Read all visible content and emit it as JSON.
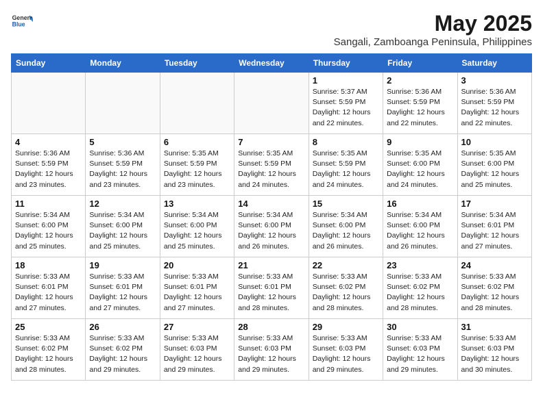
{
  "header": {
    "logo_general": "General",
    "logo_blue": "Blue",
    "month_title": "May 2025",
    "location": "Sangali, Zamboanga Peninsula, Philippines"
  },
  "days_of_week": [
    "Sunday",
    "Monday",
    "Tuesday",
    "Wednesday",
    "Thursday",
    "Friday",
    "Saturday"
  ],
  "weeks": [
    [
      {
        "day": "",
        "info": ""
      },
      {
        "day": "",
        "info": ""
      },
      {
        "day": "",
        "info": ""
      },
      {
        "day": "",
        "info": ""
      },
      {
        "day": "1",
        "info": "Sunrise: 5:37 AM\nSunset: 5:59 PM\nDaylight: 12 hours\nand 22 minutes."
      },
      {
        "day": "2",
        "info": "Sunrise: 5:36 AM\nSunset: 5:59 PM\nDaylight: 12 hours\nand 22 minutes."
      },
      {
        "day": "3",
        "info": "Sunrise: 5:36 AM\nSunset: 5:59 PM\nDaylight: 12 hours\nand 22 minutes."
      }
    ],
    [
      {
        "day": "4",
        "info": "Sunrise: 5:36 AM\nSunset: 5:59 PM\nDaylight: 12 hours\nand 23 minutes."
      },
      {
        "day": "5",
        "info": "Sunrise: 5:36 AM\nSunset: 5:59 PM\nDaylight: 12 hours\nand 23 minutes."
      },
      {
        "day": "6",
        "info": "Sunrise: 5:35 AM\nSunset: 5:59 PM\nDaylight: 12 hours\nand 23 minutes."
      },
      {
        "day": "7",
        "info": "Sunrise: 5:35 AM\nSunset: 5:59 PM\nDaylight: 12 hours\nand 24 minutes."
      },
      {
        "day": "8",
        "info": "Sunrise: 5:35 AM\nSunset: 5:59 PM\nDaylight: 12 hours\nand 24 minutes."
      },
      {
        "day": "9",
        "info": "Sunrise: 5:35 AM\nSunset: 6:00 PM\nDaylight: 12 hours\nand 24 minutes."
      },
      {
        "day": "10",
        "info": "Sunrise: 5:35 AM\nSunset: 6:00 PM\nDaylight: 12 hours\nand 25 minutes."
      }
    ],
    [
      {
        "day": "11",
        "info": "Sunrise: 5:34 AM\nSunset: 6:00 PM\nDaylight: 12 hours\nand 25 minutes."
      },
      {
        "day": "12",
        "info": "Sunrise: 5:34 AM\nSunset: 6:00 PM\nDaylight: 12 hours\nand 25 minutes."
      },
      {
        "day": "13",
        "info": "Sunrise: 5:34 AM\nSunset: 6:00 PM\nDaylight: 12 hours\nand 25 minutes."
      },
      {
        "day": "14",
        "info": "Sunrise: 5:34 AM\nSunset: 6:00 PM\nDaylight: 12 hours\nand 26 minutes."
      },
      {
        "day": "15",
        "info": "Sunrise: 5:34 AM\nSunset: 6:00 PM\nDaylight: 12 hours\nand 26 minutes."
      },
      {
        "day": "16",
        "info": "Sunrise: 5:34 AM\nSunset: 6:00 PM\nDaylight: 12 hours\nand 26 minutes."
      },
      {
        "day": "17",
        "info": "Sunrise: 5:34 AM\nSunset: 6:01 PM\nDaylight: 12 hours\nand 27 minutes."
      }
    ],
    [
      {
        "day": "18",
        "info": "Sunrise: 5:33 AM\nSunset: 6:01 PM\nDaylight: 12 hours\nand 27 minutes."
      },
      {
        "day": "19",
        "info": "Sunrise: 5:33 AM\nSunset: 6:01 PM\nDaylight: 12 hours\nand 27 minutes."
      },
      {
        "day": "20",
        "info": "Sunrise: 5:33 AM\nSunset: 6:01 PM\nDaylight: 12 hours\nand 27 minutes."
      },
      {
        "day": "21",
        "info": "Sunrise: 5:33 AM\nSunset: 6:01 PM\nDaylight: 12 hours\nand 28 minutes."
      },
      {
        "day": "22",
        "info": "Sunrise: 5:33 AM\nSunset: 6:02 PM\nDaylight: 12 hours\nand 28 minutes."
      },
      {
        "day": "23",
        "info": "Sunrise: 5:33 AM\nSunset: 6:02 PM\nDaylight: 12 hours\nand 28 minutes."
      },
      {
        "day": "24",
        "info": "Sunrise: 5:33 AM\nSunset: 6:02 PM\nDaylight: 12 hours\nand 28 minutes."
      }
    ],
    [
      {
        "day": "25",
        "info": "Sunrise: 5:33 AM\nSunset: 6:02 PM\nDaylight: 12 hours\nand 28 minutes."
      },
      {
        "day": "26",
        "info": "Sunrise: 5:33 AM\nSunset: 6:02 PM\nDaylight: 12 hours\nand 29 minutes."
      },
      {
        "day": "27",
        "info": "Sunrise: 5:33 AM\nSunset: 6:03 PM\nDaylight: 12 hours\nand 29 minutes."
      },
      {
        "day": "28",
        "info": "Sunrise: 5:33 AM\nSunset: 6:03 PM\nDaylight: 12 hours\nand 29 minutes."
      },
      {
        "day": "29",
        "info": "Sunrise: 5:33 AM\nSunset: 6:03 PM\nDaylight: 12 hours\nand 29 minutes."
      },
      {
        "day": "30",
        "info": "Sunrise: 5:33 AM\nSunset: 6:03 PM\nDaylight: 12 hours\nand 29 minutes."
      },
      {
        "day": "31",
        "info": "Sunrise: 5:33 AM\nSunset: 6:03 PM\nDaylight: 12 hours\nand 30 minutes."
      }
    ]
  ]
}
